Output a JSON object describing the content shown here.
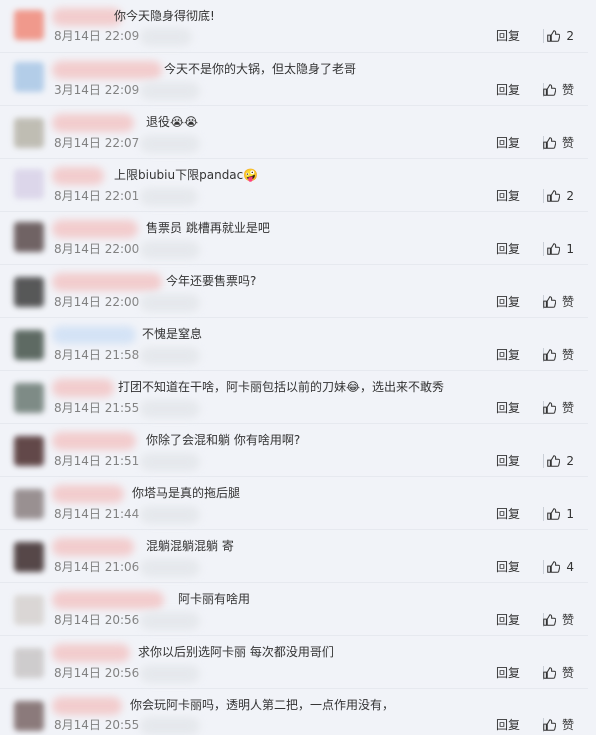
{
  "comments": [
    {
      "text": "你今天隐身得彻底!",
      "time": "8月14日 22:09",
      "reply": "回复",
      "likes": "2",
      "avatar_color": "#f08a7a",
      "name_color": "#f3c6c6",
      "emoji": ""
    },
    {
      "text": "今天不是你的大锅，但太隐身了老哥",
      "time": "3月14日 22:09",
      "reply": "回复",
      "likes": "赞",
      "avatar_color": "#a9c7e6",
      "name_color": "#f3c6c6",
      "emoji": ""
    },
    {
      "text": "退役",
      "time": "8月14日 22:07",
      "reply": "回复",
      "likes": "赞",
      "avatar_color": "#b7b4a8",
      "name_color": "#f3c6c6",
      "emoji": "😭😭"
    },
    {
      "text": "上限biubiu下限pandac",
      "time": "8月14日 22:01",
      "reply": "回复",
      "likes": "2",
      "avatar_color": "#d9d2e8",
      "name_color": "#f3c6c6",
      "emoji": "🤪"
    },
    {
      "text": "售票员 跳槽再就业是吧",
      "time": "8月14日 22:00",
      "reply": "回复",
      "likes": "1",
      "avatar_color": "#5a4b4b",
      "name_color": "#f3c6c6",
      "emoji": ""
    },
    {
      "text": "今年还要售票吗?",
      "time": "8月14日 22:00",
      "reply": "回复",
      "likes": "赞",
      "avatar_color": "#3d3d3d",
      "name_color": "#f3c6c6",
      "emoji": ""
    },
    {
      "text": "不愧是窒息",
      "time": "8月14日 21:58",
      "reply": "回复",
      "likes": "赞",
      "avatar_color": "#45534a",
      "name_color": "#cfe0f5",
      "emoji": ""
    },
    {
      "text": "打团不知道在干啥，阿卡丽包括以前的刀妹",
      "text2": "，选出来不敢秀",
      "time": "8月14日 21:55",
      "reply": "回复",
      "likes": "赞",
      "avatar_color": "#6b7a73",
      "name_color": "#f3c6c6",
      "emoji": "😂"
    },
    {
      "text": "你除了会混和躺 你有啥用啊?",
      "time": "8月14日 21:51",
      "reply": "回复",
      "likes": "2",
      "avatar_color": "#4a2b2b",
      "name_color": "#f3c6c6",
      "emoji": ""
    },
    {
      "text": "你塔马是真的拖后腿",
      "time": "8月14日 21:44",
      "reply": "回复",
      "likes": "1",
      "avatar_color": "#8a7f80",
      "name_color": "#f3c6c6",
      "emoji": ""
    },
    {
      "text": "混躺混躺混躺 寄",
      "time": "8月14日 21:06",
      "reply": "回复",
      "likes": "4",
      "avatar_color": "#3b2a2a",
      "name_color": "#f3c6c6",
      "emoji": ""
    },
    {
      "text": "阿卡丽有啥用",
      "time": "8月14日 20:56",
      "reply": "回复",
      "likes": "赞",
      "avatar_color": "#d6d2cf",
      "name_color": "#f3c6c6",
      "emoji": ""
    },
    {
      "text": "求你以后别选阿卡丽 每次都没用哥们",
      "time": "8月14日 20:56",
      "reply": "回复",
      "likes": "赞",
      "avatar_color": "#c9c6c6",
      "name_color": "#f3c6c6",
      "emoji": ""
    },
    {
      "text": "你会玩阿卡丽吗，透明人第二把，一点作用没有，",
      "time": "8月14日 20:55",
      "reply": "回复",
      "likes": "赞",
      "avatar_color": "#7a6666",
      "name_color": "#f3c6c6",
      "emoji": ""
    }
  ]
}
